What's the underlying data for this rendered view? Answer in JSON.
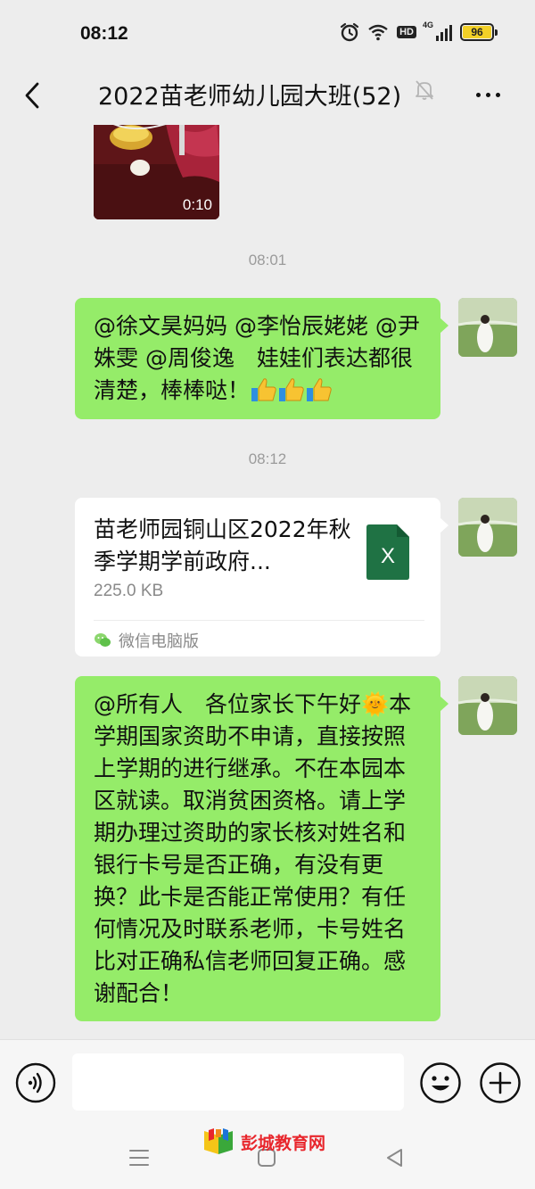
{
  "status_bar": {
    "time": "08:12",
    "hd_label": "HD",
    "network_label": "4G",
    "battery_level": "96"
  },
  "header": {
    "title": "2022苗老师幼儿园大班(52)"
  },
  "messages": {
    "video": {
      "duration": "0:10"
    },
    "timestamp_1": "08:01",
    "msg_1_text": "@徐文昊妈妈 @李怡辰姥姥 @尹姝雯 @周俊逸　娃娃们表达都很清楚，棒棒哒！",
    "timestamp_2": "08:12",
    "file": {
      "name": "苗老师园铜山区2022年秋季学期学前政府...",
      "size": "225.0 KB",
      "source": "微信电脑版",
      "icon_letter": "X"
    },
    "msg_2_text": "@所有人　各位家长下午好🌞本学期国家资助不申请，直接按照上学期的进行继承。不在本园本区就读。取消贫困资格。请上学期办理过资助的家长核对姓名和银行卡号是否正确，有没有更换？此卡是否能正常使用？有任何情况及时联系老师，卡号姓名比对正确私信老师回复正确。感谢配合！"
  },
  "input": {
    "value": "",
    "placeholder": ""
  },
  "watermark": {
    "text": "彭城教育网"
  },
  "colors": {
    "background": "#ededed",
    "outgoing_bubble": "#95ec69",
    "file_card": "#ffffff",
    "excel_green": "#1f7244",
    "battery": "#f2d027",
    "watermark_red": "#e8262c"
  },
  "icons": {
    "back": "chevron-left-icon",
    "mute": "bell-off-icon",
    "more": "more-dots-icon",
    "voice": "voice-icon",
    "emoji": "smiley-icon",
    "plus": "plus-icon",
    "alarm": "alarm-icon",
    "wifi": "wifi-icon",
    "signal": "signal-icon",
    "battery": "battery-icon",
    "thumbs_up": "thumbs-up-emoji",
    "excel": "excel-file-icon",
    "wechat": "wechat-icon"
  }
}
